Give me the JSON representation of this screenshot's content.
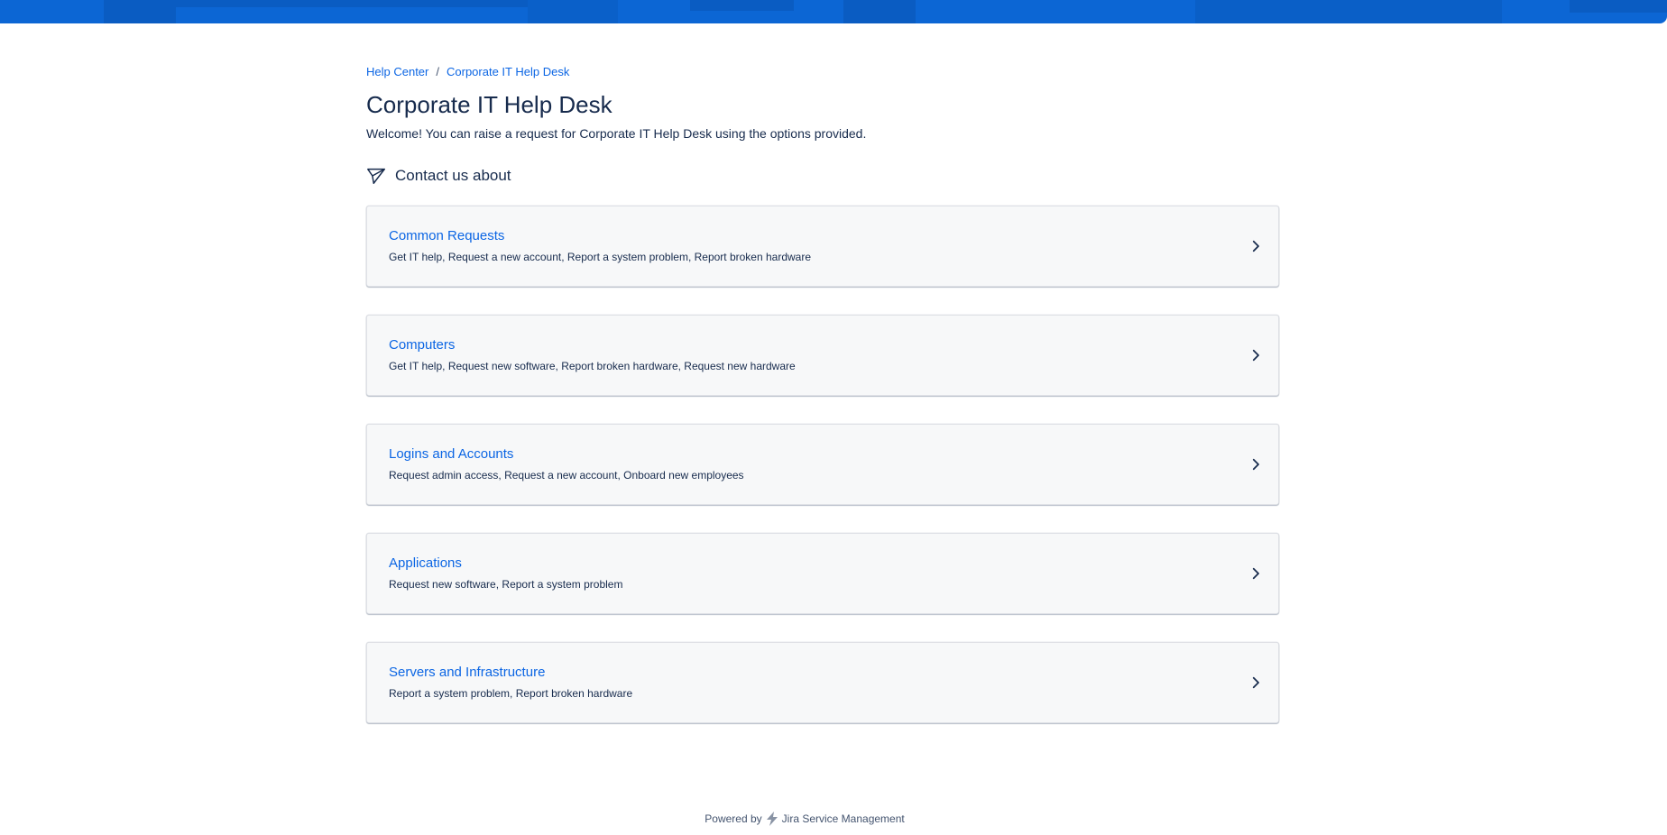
{
  "breadcrumb": {
    "items": [
      "Help Center",
      "Corporate IT Help Desk"
    ],
    "separator": "/"
  },
  "page": {
    "title": "Corporate IT Help Desk",
    "welcome": "Welcome! You can raise a request for Corporate IT Help Desk using the options provided."
  },
  "section": {
    "icon": "paper-plane-icon",
    "label": "Contact us about"
  },
  "groups": [
    {
      "title": "Common Requests",
      "description": "Get IT help, Request a new account, Report a system problem, Report broken hardware"
    },
    {
      "title": "Computers",
      "description": "Get IT help, Request new software, Report broken hardware, Request new hardware"
    },
    {
      "title": "Logins and Accounts",
      "description": "Request admin access, Request a new account, Onboard new employees"
    },
    {
      "title": "Applications",
      "description": "Request new software, Report a system problem"
    },
    {
      "title": "Servers and Infrastructure",
      "description": "Report a system problem, Report broken hardware"
    }
  ],
  "footer": {
    "powered_by": "Powered by",
    "product": "Jira Service Management"
  },
  "colors": {
    "banner": "#0c66d4",
    "link": "#0c66e4",
    "text": "#172b4d"
  }
}
